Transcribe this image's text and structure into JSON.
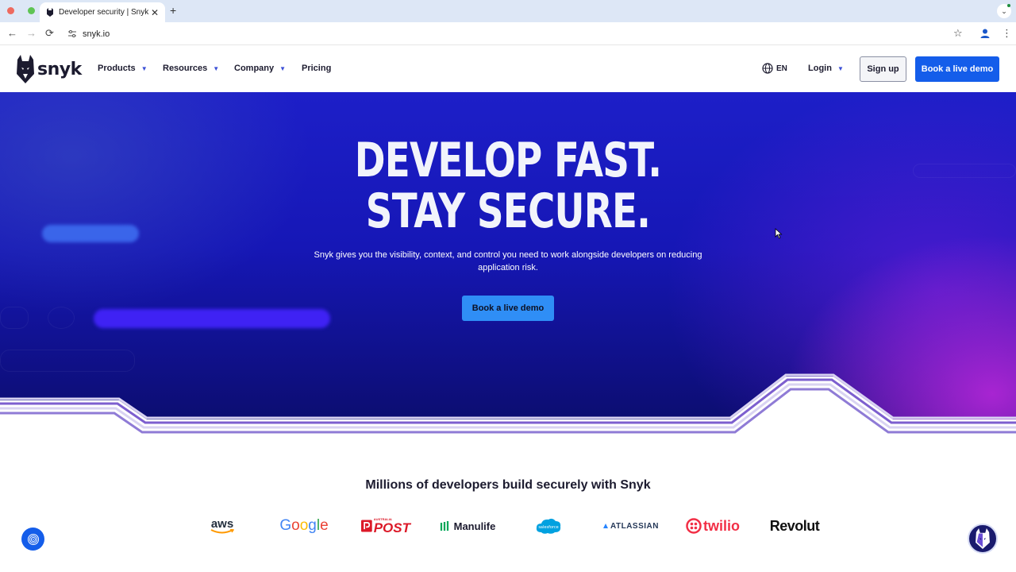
{
  "browser": {
    "tab_title": "Developer security | Snyk",
    "tab_close": "✕",
    "new_tab": "+",
    "url": "snyk.io",
    "back": "←",
    "forward": "→",
    "reload": "⟳",
    "bookmark": "☆",
    "menu": "⋮",
    "tab_menu": "⌄"
  },
  "nav": {
    "logo_text": "snyk",
    "items": [
      {
        "label": "Products",
        "icon": "chevron-down-icon"
      },
      {
        "label": "Resources",
        "icon": "chevron-down-icon"
      },
      {
        "label": "Company",
        "icon": "chevron-down-icon"
      },
      {
        "label": "Pricing"
      }
    ],
    "language": "EN",
    "login": "Login",
    "signup": "Sign up",
    "demo": "Book a live demo"
  },
  "hero": {
    "headline_line1": "DEVELOP FAST.",
    "headline_line2": "STAY SECURE.",
    "subtitle": "Snyk gives you the visibility, context, and control you need to work alongside developers on reducing application risk.",
    "cta": "Book a live demo"
  },
  "customers": {
    "title": "Millions of developers build securely with Snyk",
    "logos": {
      "aws": "aws",
      "google": [
        "G",
        "o",
        "o",
        "g",
        "l",
        "e"
      ],
      "auspost_small": "AUSTRALIA",
      "auspost": "POST",
      "manulife": "Manulife",
      "salesforce": "salesforce",
      "atlassian": "ATLASSIAN",
      "twilio": "twilio",
      "revolut": "Revolut"
    }
  },
  "colors": {
    "brand_blue": "#145dea",
    "hero_cta": "#2f8ef6",
    "google": [
      "#4285f4",
      "#ea4335",
      "#fbbc05",
      "#4285f4",
      "#34a853",
      "#ea4335"
    ]
  }
}
